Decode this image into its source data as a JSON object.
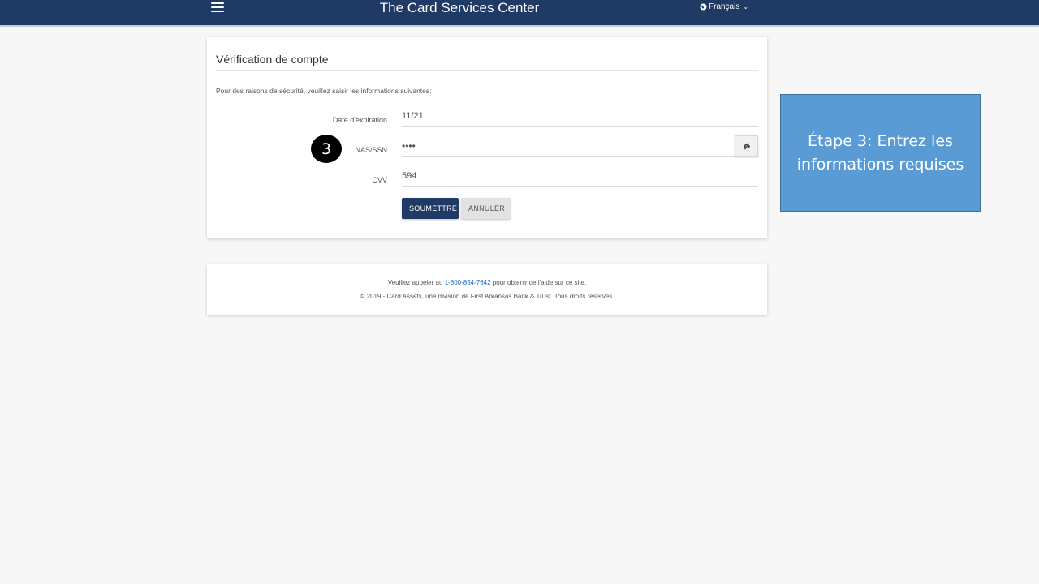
{
  "header": {
    "title": "The Card Services Center",
    "language_label": "Français",
    "menu_icon": "hamburger-menu-icon",
    "language_icon": "globe-icon",
    "language_chevron": "chevron-down-icon",
    "background_color": "#203a66"
  },
  "form": {
    "title": "Vérification de compte",
    "instruction": "Pour des raisons de sécurité, veuillez saisir les informations suivantes:",
    "fields": [
      {
        "label": "Date d'expiration",
        "value": "11/21"
      },
      {
        "label": "NAS/SSN",
        "value": "••••"
      },
      {
        "label": "CVV",
        "value": "594"
      }
    ],
    "toggle_icon": "eye-slash-icon",
    "submit_label": "SOUMETTRE",
    "cancel_label": "ANNULER"
  },
  "footer": {
    "line1_prefix": "Veuillez appeler au ",
    "phone_link": "1-800-854-7642",
    "line1_suffix": " pour obtenir de l'aide sur ce site.",
    "line2": "© 2019 - Card Assets, une division de First Arkansas Bank & Trust. Tous droits réservés."
  },
  "annotation": {
    "step_number": "3",
    "callout_text": "Étape 3: Entrez les informations requises",
    "callout_color": "#5b9bd5"
  }
}
